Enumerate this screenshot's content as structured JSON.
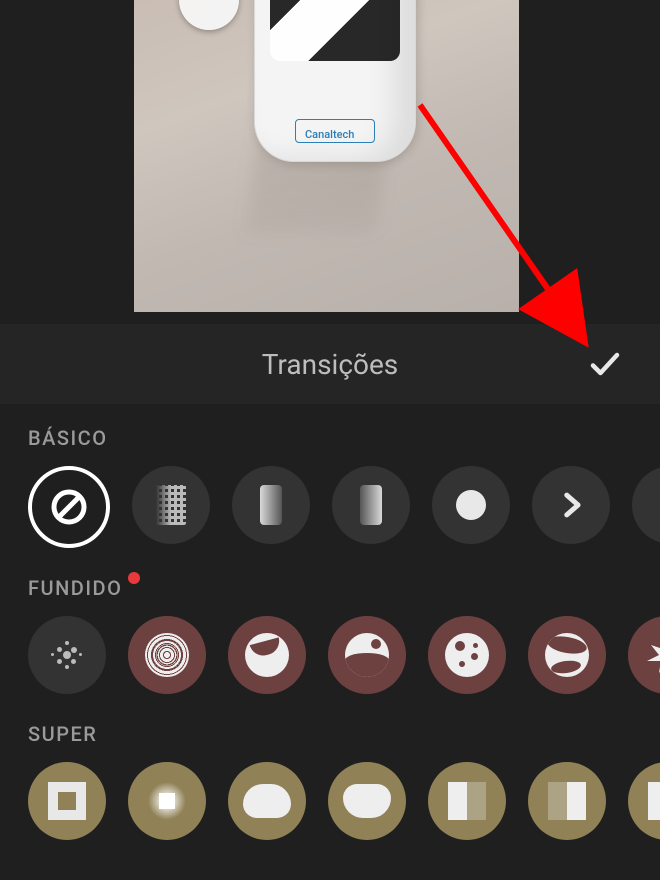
{
  "preview": {
    "logo_text": "Canaltech"
  },
  "panel": {
    "title": "Transições",
    "confirm_aria": "Confirm"
  },
  "sections": {
    "basic": {
      "label": "BÁSICO",
      "options": [
        {
          "name": "none",
          "selected": true
        },
        {
          "name": "dissolve"
        },
        {
          "name": "fade-right"
        },
        {
          "name": "fade-left"
        },
        {
          "name": "iris"
        },
        {
          "name": "slide-next"
        },
        {
          "name": "slide-prev"
        }
      ]
    },
    "dissolve": {
      "label": "FUNDIDO",
      "has_new_indicator": true,
      "options": [
        {
          "name": "halftone-1"
        },
        {
          "name": "halftone-2"
        },
        {
          "name": "swirl"
        },
        {
          "name": "liquid"
        },
        {
          "name": "bubbles"
        },
        {
          "name": "globe"
        },
        {
          "name": "splat"
        }
      ]
    },
    "super": {
      "label": "SUPER",
      "options": [
        {
          "name": "zoom-square"
        },
        {
          "name": "glow-square"
        },
        {
          "name": "morph-1"
        },
        {
          "name": "morph-2"
        },
        {
          "name": "split-left"
        },
        {
          "name": "split-right"
        },
        {
          "name": "split-3"
        }
      ]
    }
  },
  "annotation": {
    "type": "arrow",
    "color": "#ff0000",
    "points_to": "confirm-button"
  }
}
